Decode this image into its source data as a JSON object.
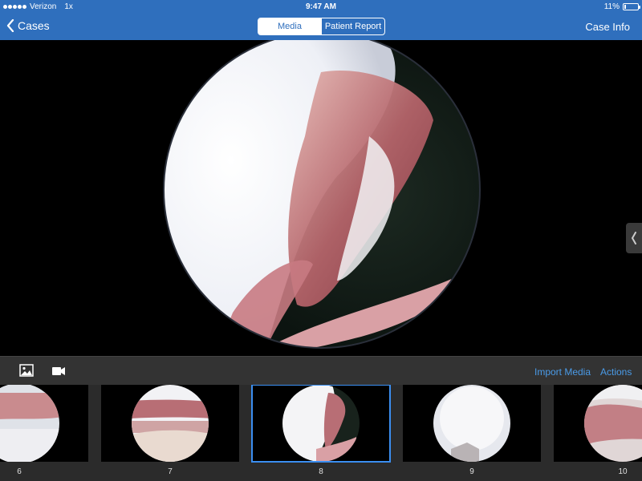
{
  "status_bar": {
    "carrier": "Verizon",
    "zoom": "1x",
    "time": "9:47 AM",
    "battery_percent": "11%",
    "battery_level": 0.11
  },
  "nav": {
    "back_label": "Cases",
    "segments": [
      {
        "label": "Media",
        "active": true
      },
      {
        "label": "Patient Report",
        "active": false
      }
    ],
    "case_info_label": "Case Info"
  },
  "toolbar": {
    "photo_icon": "photo-icon",
    "video_icon": "video-camera-icon",
    "import_label": "Import Media",
    "actions_label": "Actions"
  },
  "thumbnails": [
    {
      "label": "6",
      "selected": false
    },
    {
      "label": "7",
      "selected": false
    },
    {
      "label": "8",
      "selected": true
    },
    {
      "label": "9",
      "selected": false
    },
    {
      "label": "10",
      "selected": false
    }
  ],
  "colors": {
    "nav_blue": "#2f6fbd",
    "link_blue": "#4a9be8",
    "selected_outline": "#3b8ef0",
    "toolbar_bg": "#333333"
  }
}
